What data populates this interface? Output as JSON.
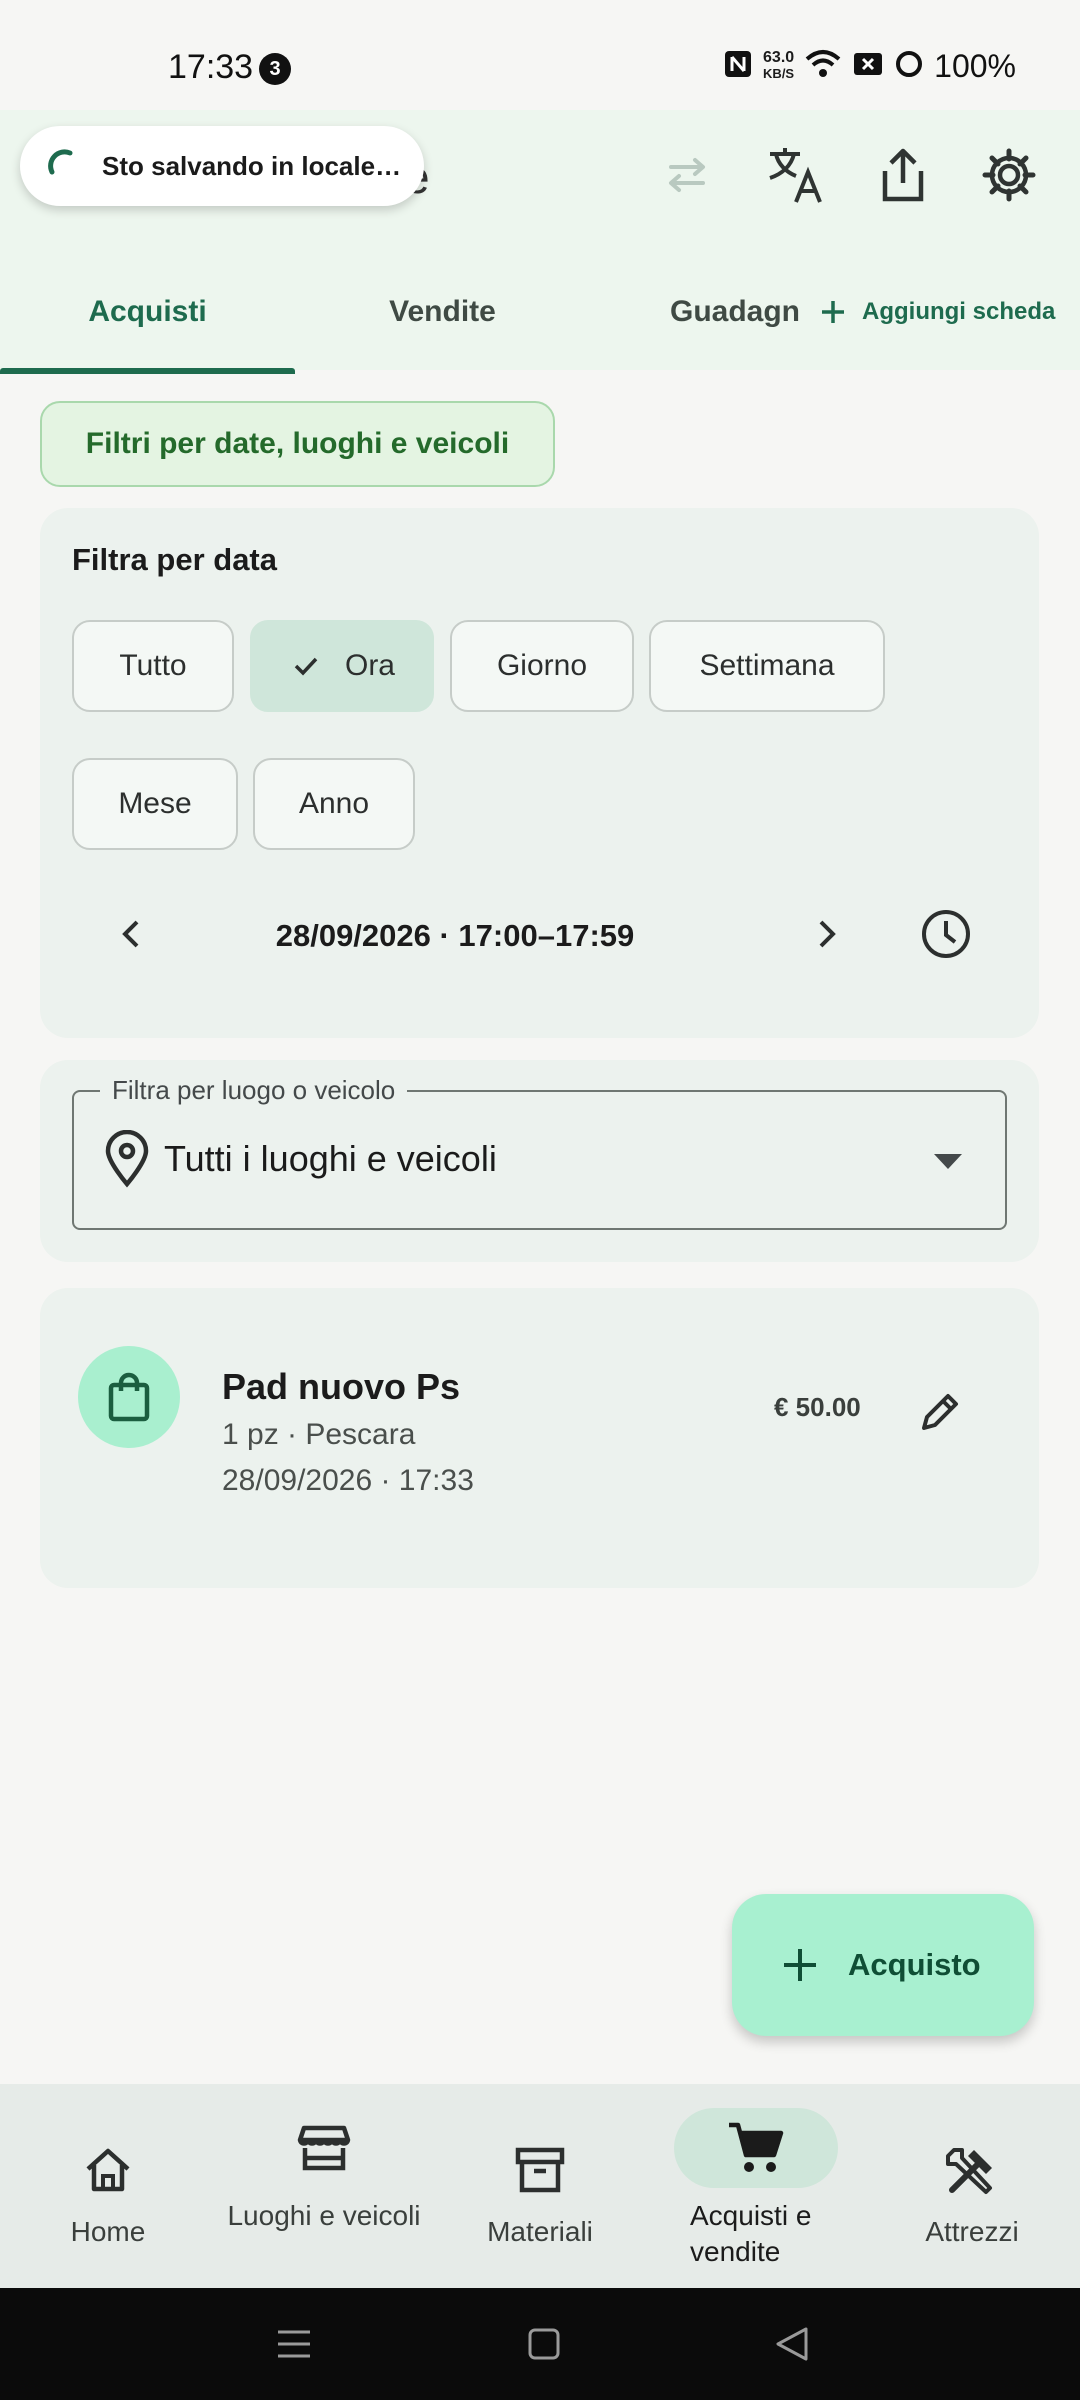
{
  "status_bar": {
    "time": "17:33",
    "notification_count": "3",
    "net_speed_value": "63.0",
    "net_speed_unit": "KB/S",
    "battery": "100%"
  },
  "header": {
    "title_visible": "e",
    "toast": "Sto salvando in locale…",
    "icons": [
      "swap-icon",
      "translate-icon",
      "share-icon",
      "gear-icon"
    ]
  },
  "tabs": {
    "items": [
      {
        "label": "Acquisti",
        "active": true
      },
      {
        "label": "Vendite",
        "active": false
      },
      {
        "label": "Guadagn",
        "active": false
      }
    ],
    "add_label": "Aggiungi scheda"
  },
  "filters_button": "Filtri per date, luoghi e veicoli",
  "date_filter": {
    "title": "Filtra per data",
    "chips": [
      {
        "label": "Tutto",
        "selected": false
      },
      {
        "label": "Ora",
        "selected": true
      },
      {
        "label": "Giorno",
        "selected": false
      },
      {
        "label": "Settimana",
        "selected": false
      },
      {
        "label": "Mese",
        "selected": false
      },
      {
        "label": "Anno",
        "selected": false
      }
    ],
    "range_label": "28/09/2026 · 17:00–17:59"
  },
  "place_filter": {
    "legend": "Filtra per luogo o veicolo",
    "value": "Tutti i luoghi e veicoli"
  },
  "items": [
    {
      "name": "Pad nuovo Ps",
      "sub": "1 pz · Pescara",
      "date": "28/09/2026 · 17:33",
      "price": "€ 50.00"
    }
  ],
  "fab": {
    "label": "Acquisto"
  },
  "bottom_nav": [
    {
      "label": "Home",
      "icon": "home-icon",
      "active": false
    },
    {
      "label": "Luoghi e veicoli",
      "icon": "store-icon",
      "active": false
    },
    {
      "label": "Materiali",
      "icon": "archive-icon",
      "active": false
    },
    {
      "label": "Acquisti e vendite",
      "icon": "cart-icon",
      "active": true
    },
    {
      "label": "Attrezzi",
      "icon": "tools-icon",
      "active": false
    }
  ],
  "colors": {
    "accent": "#1e6b4e",
    "header_bg": "#edf6ee",
    "card_bg": "#ecf2ee",
    "fab_bg": "#a8f0d0",
    "chip_selected": "#cfe6da"
  }
}
